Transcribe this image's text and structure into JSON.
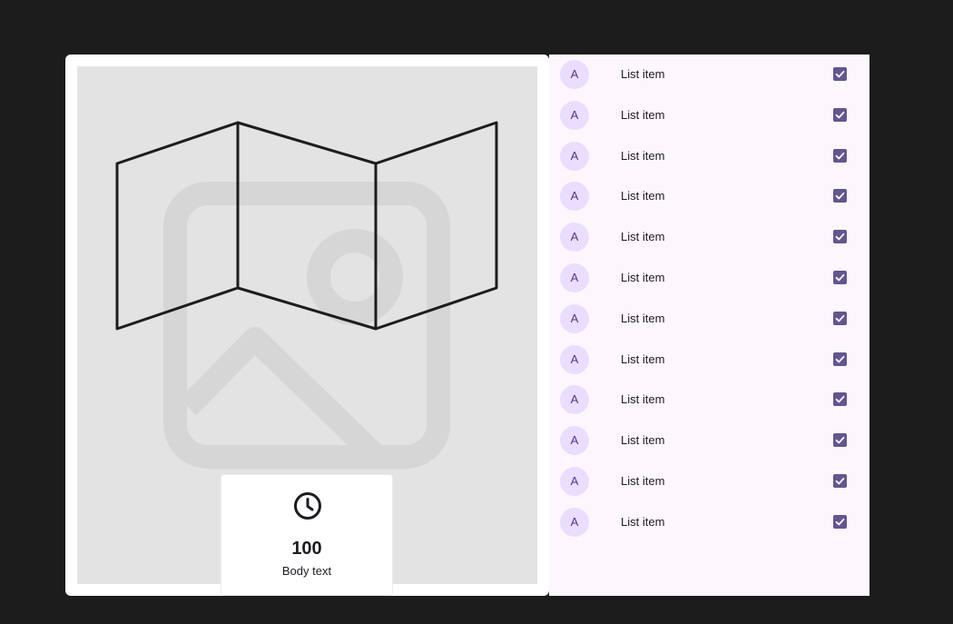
{
  "stat_card": {
    "icon": "clock-icon",
    "value": "100",
    "label": "Body text"
  },
  "media": {
    "placeholder_icon": "image-placeholder-icon",
    "overlay_icon": "folded-map-icon"
  },
  "list": {
    "items": [
      {
        "avatar": "A",
        "label": "List item",
        "checked": true
      },
      {
        "avatar": "A",
        "label": "List item",
        "checked": true
      },
      {
        "avatar": "A",
        "label": "List item",
        "checked": true
      },
      {
        "avatar": "A",
        "label": "List item",
        "checked": true
      },
      {
        "avatar": "A",
        "label": "List item",
        "checked": true
      },
      {
        "avatar": "A",
        "label": "List item",
        "checked": true
      },
      {
        "avatar": "A",
        "label": "List item",
        "checked": true
      },
      {
        "avatar": "A",
        "label": "List item",
        "checked": true
      },
      {
        "avatar": "A",
        "label": "List item",
        "checked": true
      },
      {
        "avatar": "A",
        "label": "List item",
        "checked": true
      },
      {
        "avatar": "A",
        "label": "List item",
        "checked": true
      },
      {
        "avatar": "A",
        "label": "List item",
        "checked": true
      }
    ]
  },
  "colors": {
    "background": "#1c1c1c",
    "card": "#ffffff",
    "media": "#e3e3e3",
    "list_panel": "#fdf7fd",
    "avatar_bg": "#eaddff",
    "avatar_text": "#4f378b",
    "checkbox": "#65558f"
  }
}
